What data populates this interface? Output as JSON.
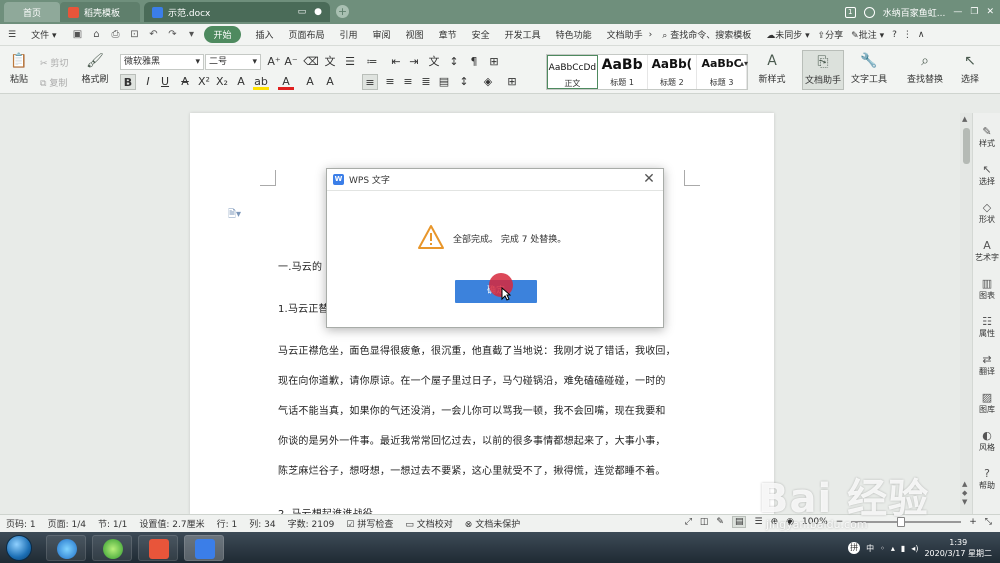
{
  "titlebar": {
    "tabs": [
      {
        "label": "首页"
      },
      {
        "label": "稻壳模板"
      },
      {
        "label": "示范.docx"
      }
    ],
    "right_label": "水纳百家鱼虹...",
    "window_controls": [
      "minimize-icon",
      "restore-icon",
      "close-icon"
    ]
  },
  "menubar": {
    "file": "文件",
    "items": [
      "开始",
      "插入",
      "页面布局",
      "引用",
      "审阅",
      "视图",
      "章节",
      "安全",
      "开发工具",
      "特色功能",
      "文档助手"
    ],
    "search_placeholder": "查找命令、搜索模板",
    "sync": "未同步",
    "share": "分享",
    "comment": "批注"
  },
  "ribbon": {
    "paste": "粘贴",
    "cut": "剪切",
    "copy": "复制",
    "format_painter": "格式刷",
    "font_name": "微软雅黑",
    "font_size": "二号",
    "styles": [
      {
        "preview": "AaBbCcDd",
        "label": "正文"
      },
      {
        "preview": "AaBb",
        "label": "标题 1"
      },
      {
        "preview": "AaBb(",
        "label": "标题 2"
      },
      {
        "preview": "AaBbC",
        "label": "标题 3"
      }
    ],
    "new_style": "新样式",
    "doc_helper": "文档助手",
    "text_tools": "文字工具",
    "find_replace": "查找替换",
    "select": "选择"
  },
  "document": {
    "lines": [
      "一.马云的",
      "1.马云正替",
      "马云正襟危坐，面色显得很疲惫，很沉重，他直截了当地说：我刚才说了错话，我收回，",
      "现在向你道歉，请你原谅。在一个屋子里过日子，马勺碰锅沿，难免磕磕碰碰，一时的",
      "气话不能当真，如果你的气还没消，一会儿你可以骂我一顿，我不会回嘴，现在我要和",
      "你谈的是另外一件事。最近我常常回忆过去，以前的很多事情都想起来了，大事小事，",
      "陈芝麻烂谷子，想呀想，一想过去不要紧，这心里就受不了，揪得慌，连觉都睡不着。",
      "2. 马云想起谁谁战役"
    ]
  },
  "sidepanel": {
    "items": [
      "样式",
      "选择",
      "形状",
      "艺术字",
      "图表",
      "属性",
      "翻译",
      "图库",
      "风格",
      "帮助"
    ]
  },
  "dialog": {
    "title": "WPS 文字",
    "message": "全部完成。 完成 7 处替换。",
    "ok": "确定"
  },
  "statusbar": {
    "items": [
      "页码: 1",
      "页面: 1/4",
      "节: 1/1",
      "设置值: 2.7厘米",
      "行: 1",
      "列: 34",
      "字数: 2109",
      "拼写检查",
      "文档校对",
      "文档未保护"
    ],
    "zoom": "100%",
    "zoom_level": 0.45
  },
  "taskbar": {
    "ime": "中",
    "time": "1:39",
    "date": "2020/3/17 星期二"
  },
  "watermark": {
    "brand": "Bai 经验",
    "url": "jingyan.baidu.com"
  }
}
